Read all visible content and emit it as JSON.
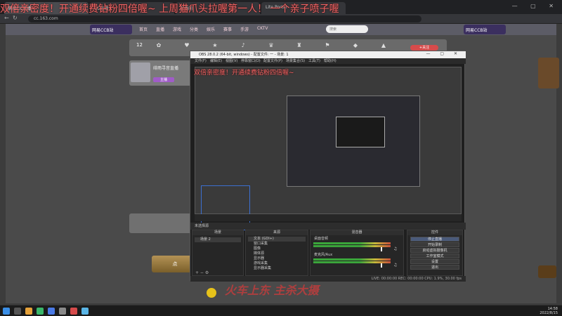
{
  "browser": {
    "tabs": [
      {
        "label": "网易CC直播"
      },
      {
        "label": "CC直播"
      },
      {
        "label": "直播间"
      },
      {
        "label": "Lite Portal"
      }
    ],
    "url": "cc.163.com"
  },
  "danmaku": {
    "main": "双倍亲密度！开通续费钻粉四倍喔~ 上周猫爪头拉喔第一人！ 一个亲子喷子喔",
    "preview": "双倍亲密度！开通续费钻粉四倍喔~ "
  },
  "site": {
    "logo": "网易CCB站",
    "nav": [
      "首页",
      "直播",
      "游戏",
      "分类",
      "娱乐",
      "赛事",
      "手游",
      "CKTV"
    ],
    "search_placeholder": "搜索",
    "right_logo": "网易CCB站"
  },
  "room": {
    "number": "12",
    "follow_label": "+关注",
    "streamer_name": "绯雨寻音直播",
    "streamer_tag": "主播",
    "gold_label": "点"
  },
  "obs": {
    "title": "OBS 28.0.2 (64-bit, windows) - 配置文件: 一 - 场景: 1",
    "menu": [
      "文件(F)",
      "编辑(E)",
      "视图(V)",
      "停靠窗口(D)",
      "配置文件(P)",
      "场景集合(S)",
      "工具(T)",
      "帮助(H)"
    ],
    "mode_bar": "未选择源",
    "docks": {
      "scenes": {
        "title": "场景",
        "items": [
          "场景 2"
        ]
      },
      "sources": {
        "title": "来源",
        "items": [
          "文本 (GDI+)",
          "窗口采集",
          "图像",
          "媒体源",
          "显示器",
          "游戏采集",
          "显示器采集"
        ]
      },
      "mixer": {
        "title": "混音器",
        "items": [
          "桌面音频",
          "麦克风/Aux"
        ]
      },
      "controls": {
        "title": "控件",
        "items": [
          "停止直播",
          "开始录制",
          "启动虚拟摄像机",
          "工作室模式",
          "设置",
          "退出"
        ]
      },
      "filters": {
        "title": "滤镜",
        "items": [
          "色彩校正",
          "画面"
        ]
      }
    },
    "status": "LIVE: 00:00:00  REC: 00:00:00  CPU: 1.9%, 30.00 fps"
  },
  "watermark": "火车上东 主杀大摄",
  "taskbar": {
    "time": "14:58",
    "date": "2022/8/15"
  }
}
